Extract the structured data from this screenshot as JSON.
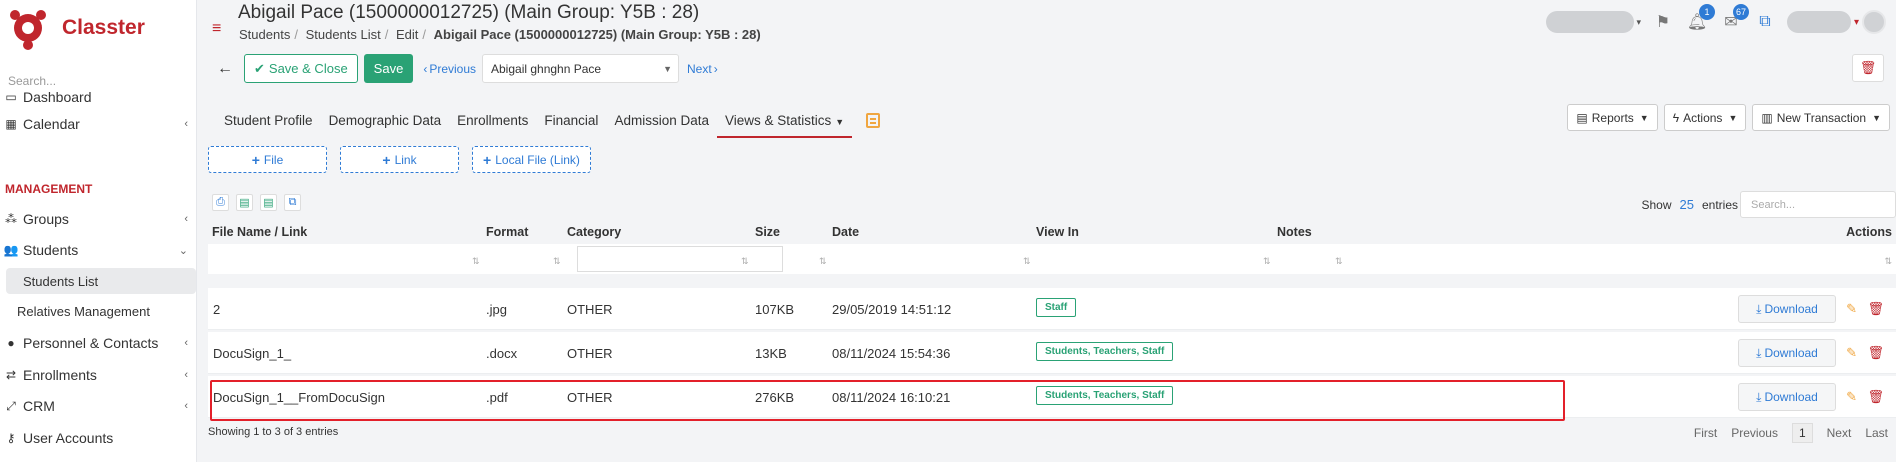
{
  "app": {
    "name": "Classter"
  },
  "sidebar": {
    "search_placeholder": "Search...",
    "section_management": "MANAGEMENT",
    "items": [
      {
        "label": "Dashboard",
        "icon": "monitor-icon"
      },
      {
        "label": "Calendar",
        "icon": "calendar-icon"
      },
      {
        "label": "Groups",
        "icon": "groups-icon"
      },
      {
        "label": "Students",
        "icon": "students-icon"
      },
      {
        "label": "Students List"
      },
      {
        "label": "Relatives Management"
      },
      {
        "label": "Personnel & Contacts",
        "icon": "person-icon"
      },
      {
        "label": "Enrollments",
        "icon": "exchange-icon"
      },
      {
        "label": "CRM",
        "icon": "crm-icon"
      },
      {
        "label": "User Accounts",
        "icon": "key-icon"
      }
    ]
  },
  "header": {
    "title": "Abigail Pace (1500000012725) (Main Group: Y5B : 28)",
    "breadcrumbs": [
      "Students",
      "Students List",
      "Edit",
      "Abigail Pace (1500000012725) (Main Group: Y5B : 28)"
    ],
    "notifications_count": "1",
    "messages_count": "67"
  },
  "toolbar": {
    "save_close_label": "Save & Close",
    "save_label": "Save",
    "previous_label": "Previous",
    "next_label": "Next",
    "student_selected": "Abigail ghnghn Pace"
  },
  "tabs": [
    {
      "label": "Student Profile"
    },
    {
      "label": "Demographic Data"
    },
    {
      "label": "Enrollments"
    },
    {
      "label": "Financial"
    },
    {
      "label": "Admission Data"
    },
    {
      "label": "Views & Statistics"
    }
  ],
  "right_tools": {
    "reports": "Reports",
    "actions": "Actions",
    "new_transaction": "New Transaction"
  },
  "add_buttons": {
    "file": "File",
    "link": "Link",
    "local_file": "Local File (Link)"
  },
  "table_controls": {
    "show_label": "Show",
    "page_size": "25",
    "entries_label": "entries",
    "search_placeholder": "Search..."
  },
  "table": {
    "columns": [
      "File Name / Link",
      "Format",
      "Category",
      "Size",
      "Date",
      "View In",
      "Notes",
      "Actions"
    ],
    "rows": [
      {
        "name": "2",
        "format": ".jpg",
        "category": "OTHER",
        "size": "107KB",
        "date": "29/05/2019 14:51:12",
        "view_in": "Staff",
        "action": "Download"
      },
      {
        "name": "DocuSign_1_",
        "format": ".docx",
        "category": "OTHER",
        "size": "13KB",
        "date": "08/11/2024 15:54:36",
        "view_in": "Students, Teachers, Staff",
        "action": "Download"
      },
      {
        "name": "DocuSign_1__FromDocuSign",
        "format": ".pdf",
        "category": "OTHER",
        "size": "276KB",
        "date": "08/11/2024 16:10:21",
        "view_in": "Students, Teachers, Staff",
        "action": "Download"
      }
    ]
  },
  "footer": {
    "info": "Showing 1 to 3 of 3 entries",
    "first": "First",
    "previous": "Previous",
    "current_page": "1",
    "next": "Next",
    "last": "Last"
  },
  "colors": {
    "brand_red": "#c0262d",
    "green": "#2aa275",
    "link_blue": "#2f7bd5",
    "highlight_red": "#e3202a"
  }
}
